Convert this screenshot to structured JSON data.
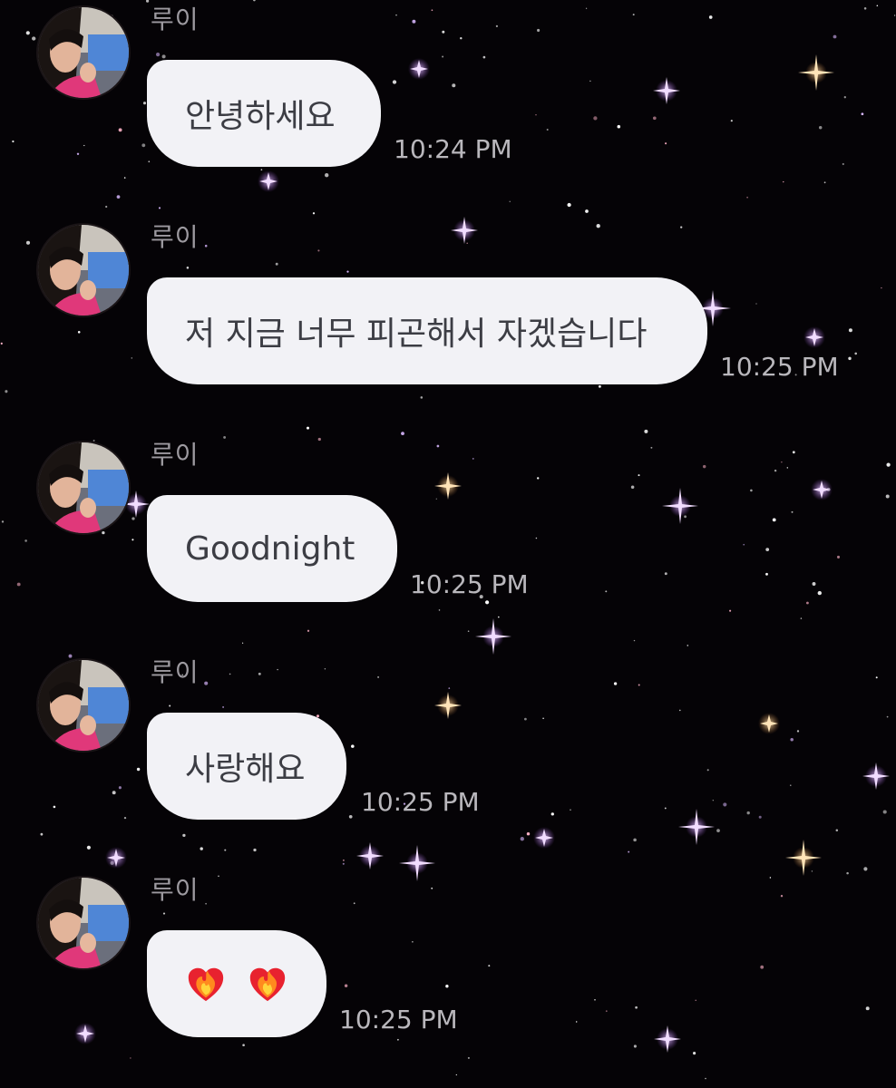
{
  "background": {
    "color": "#050306",
    "star_color": "#ffffff",
    "sparkle_color": "#c89cf0"
  },
  "bubble_color": "#f2f2f6",
  "messages": [
    {
      "sender": "루이",
      "text": "안녕하세요",
      "time": "10:24 PM"
    },
    {
      "sender": "루이",
      "text": "저 지금 너무 피곤해서 자겠습니다",
      "time": "10:25 PM"
    },
    {
      "sender": "루이",
      "text": "Goodnight",
      "time": "10:25 PM"
    },
    {
      "sender": "루이",
      "text": "사랑해요",
      "time": "10:25 PM"
    },
    {
      "sender": "루이",
      "emojis": [
        "heart-on-fire-icon",
        "heart-on-fire-icon"
      ],
      "time": "10:25 PM"
    }
  ]
}
